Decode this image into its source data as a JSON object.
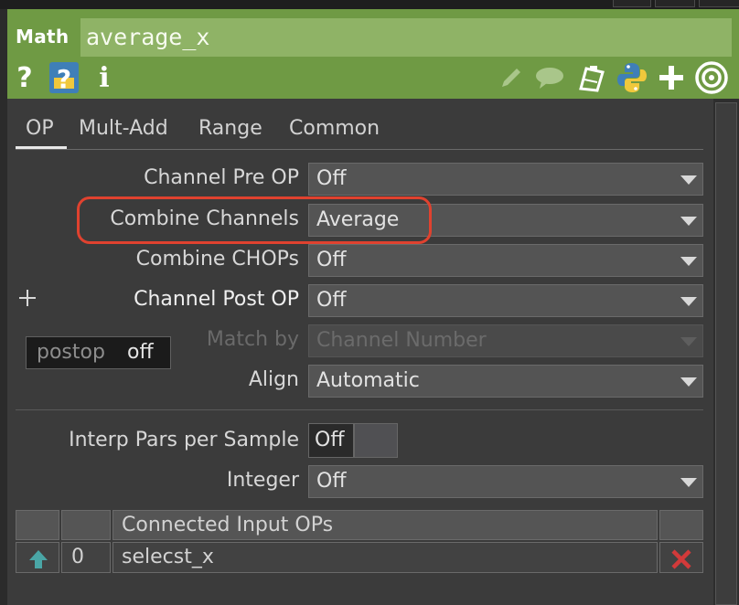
{
  "header": {
    "op_type": "Math",
    "op_name": "average_x",
    "left_icons": [
      "help-icon",
      "python-help-icon",
      "info-icon"
    ],
    "right_icons": [
      "pencil-icon",
      "comment-icon",
      "clipboard-icon",
      "python-icon",
      "add-icon",
      "viewer-target-icon"
    ]
  },
  "tabs": [
    {
      "label": "OP",
      "active": true
    },
    {
      "label": "Mult-Add"
    },
    {
      "label": "Range"
    },
    {
      "label": "Common"
    }
  ],
  "params": {
    "channel_pre_op": {
      "label": "Channel Pre OP",
      "value": "Off"
    },
    "combine_channels": {
      "label": "Combine Channels",
      "value": "Average"
    },
    "combine_chops": {
      "label": "Combine CHOPs",
      "value": "Off"
    },
    "channel_post_op": {
      "label": "Channel Post OP",
      "value": "Off"
    },
    "match_by": {
      "label": "Match by",
      "value": "Channel Number",
      "disabled": true
    },
    "align": {
      "label": "Align",
      "value": "Automatic"
    },
    "interp_pars": {
      "label": "Interp Pars per Sample",
      "value": "Off"
    },
    "integer": {
      "label": "Integer",
      "value": "Off"
    }
  },
  "tooltip": {
    "name": "postop",
    "value": "off"
  },
  "inputs_table": {
    "header": "Connected Input OPs",
    "rows": [
      {
        "index": "0",
        "name": "selecst_x"
      }
    ]
  },
  "colors": {
    "header_green": "#6f9a44",
    "name_field": "#8fb366",
    "highlight": "#e0422f",
    "remove_red": "#d23a3a",
    "arrow_teal": "#4aa6a6"
  }
}
